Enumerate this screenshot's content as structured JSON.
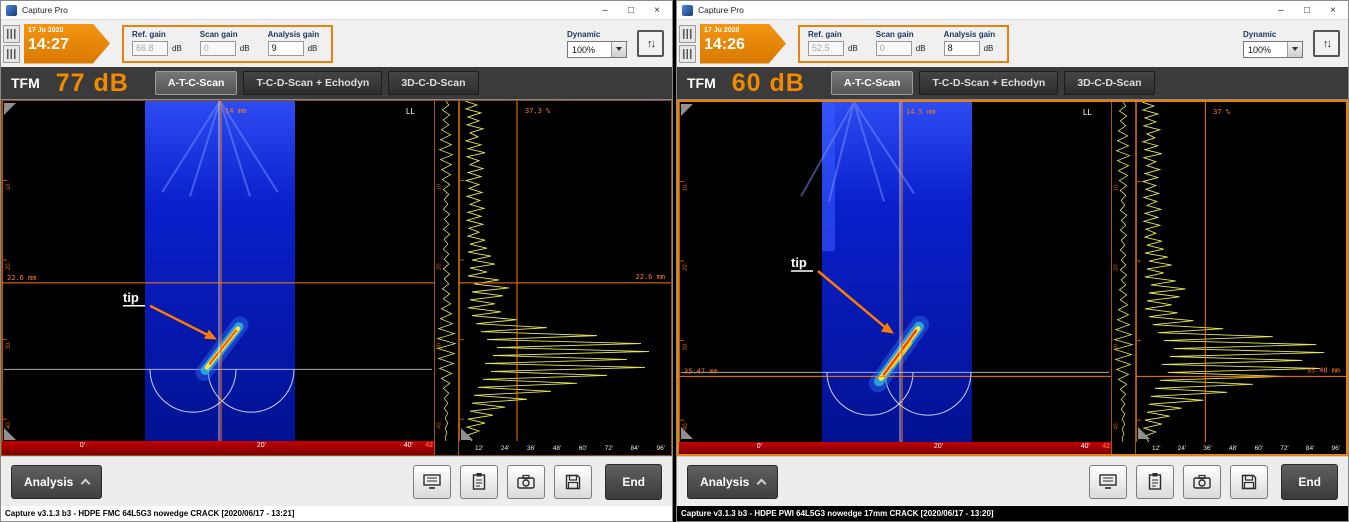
{
  "colors": {
    "accent_orange": "#E8820C",
    "cursor_orange": "#FF7A00",
    "trace_yellow": "#E6E650",
    "axis_red": "#A00000"
  },
  "windows": {
    "left": {
      "title": "Capture Pro",
      "controls": {
        "minimize": "–",
        "maximize": "□",
        "close": "×"
      },
      "toolbar": {
        "date": "17 Ju 2020",
        "time": "14:27",
        "fields": [
          {
            "label": "Ref. gain",
            "value": "66.8",
            "unit": "dB"
          },
          {
            "label": "Scan gain",
            "value": "0",
            "unit": "dB"
          },
          {
            "label": "Analysis gain",
            "value": "9",
            "unit": "dB"
          }
        ],
        "dynamic_label": "Dynamic",
        "dynamic_value": "100%",
        "updown_icon": "↑↓"
      },
      "header": {
        "mode": "TFM",
        "gain": "77 dB",
        "tabs": [
          "A-T-C-Scan",
          "T-C-D-Scan + Echodyn",
          "3D-C-D-Scan"
        ],
        "active_tab": "A-T-C-Scan"
      },
      "scan": {
        "cursor_x_label": "14 mm",
        "depth_label": "22.6 mm",
        "wave_mode": "LL",
        "annotation": "tip",
        "depth_ticks": [
          "10.",
          "20.",
          "30.",
          "40."
        ],
        "x_ticks": [
          "0'",
          "20'",
          "40'"
        ],
        "x_end": "42",
        "side": {
          "amplitude": "37.3 %",
          "depth": "22.6 mm",
          "ticks": [
            "12'",
            "24'",
            "36'",
            "48'",
            "60'",
            "72'",
            "84'",
            "96'"
          ]
        }
      },
      "footer": {
        "analysis": "Analysis",
        "end": "End",
        "icons": [
          "screen-icon",
          "report-icon",
          "camera-icon",
          "save-icon"
        ]
      },
      "status": "Capture v3.1.3 b3 - HDPE FMC 64L5G3 nowedge CRACK [2020/06/17 - 13:21]"
    },
    "right": {
      "title": "Capture Pro",
      "controls": {
        "minimize": "–",
        "maximize": "□",
        "close": "×"
      },
      "toolbar": {
        "date": "17 Ju 2020",
        "time": "14:26",
        "fields": [
          {
            "label": "Ref. gain",
            "value": "52.5",
            "unit": "dB"
          },
          {
            "label": "Scan gain",
            "value": "0",
            "unit": "dB"
          },
          {
            "label": "Analysis gain",
            "value": "8",
            "unit": "dB"
          }
        ],
        "dynamic_label": "Dynamic",
        "dynamic_value": "100%",
        "updown_icon": "↑↓"
      },
      "header": {
        "mode": "TFM",
        "gain": "60 dB",
        "tabs": [
          "A-T-C-Scan",
          "T-C-D-Scan + Echodyn",
          "3D-C-D-Scan"
        ],
        "active_tab": "A-T-C-Scan"
      },
      "scan": {
        "cursor_x_label": "14.5 mm",
        "depth_label": "35.47 mm",
        "wave_mode": "LL",
        "annotation": "tip",
        "depth_ticks": [
          "10.",
          "20.",
          "30.",
          "40."
        ],
        "x_ticks": [
          "0'",
          "20'",
          "40'"
        ],
        "x_end": "42",
        "side": {
          "amplitude": "37 %",
          "depth": "35.48 mm",
          "ticks": [
            "12'",
            "24'",
            "36'",
            "48'",
            "60'",
            "72'",
            "84'",
            "96'"
          ]
        }
      },
      "footer": {
        "analysis": "Analysis",
        "end": "End",
        "icons": [
          "screen-icon",
          "report-icon",
          "camera-icon",
          "save-icon"
        ]
      },
      "status": "Capture v3.1.3 b3 - HDPE PWI 64L5G3 nowedge 17mm CRACK [2020/06/17 - 13:20]"
    }
  }
}
